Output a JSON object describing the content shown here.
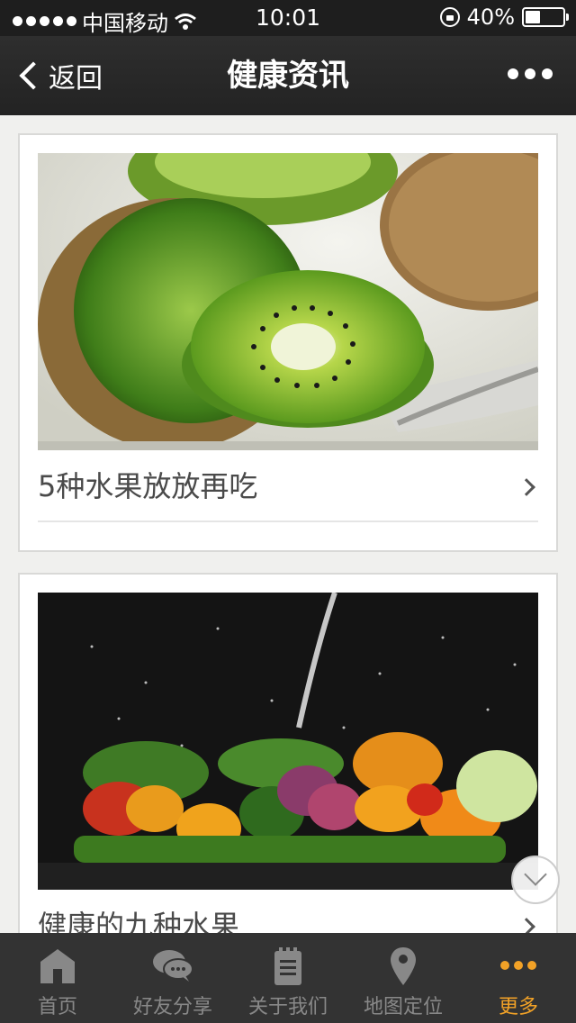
{
  "status": {
    "carrier": "中国移动",
    "time": "10:01",
    "battery_text": "40%",
    "battery_level": 0.4
  },
  "nav": {
    "back_label": "返回",
    "title": "健康资讯"
  },
  "articles": [
    {
      "title": "5种水果放放再吃"
    },
    {
      "title": "健康的九种水果"
    }
  ],
  "tabs": [
    {
      "label": "首页",
      "icon": "home-icon"
    },
    {
      "label": "好友分享",
      "icon": "chat-bubbles-icon"
    },
    {
      "label": "关于我们",
      "icon": "notepad-icon"
    },
    {
      "label": "地图定位",
      "icon": "map-pin-icon"
    },
    {
      "label": "更多",
      "icon": "more-dots-icon"
    }
  ],
  "colors": {
    "accent": "#f2a227",
    "tab_inactive": "#888888",
    "tabbar_bg": "#333333",
    "navbar_bg": "#262626"
  }
}
